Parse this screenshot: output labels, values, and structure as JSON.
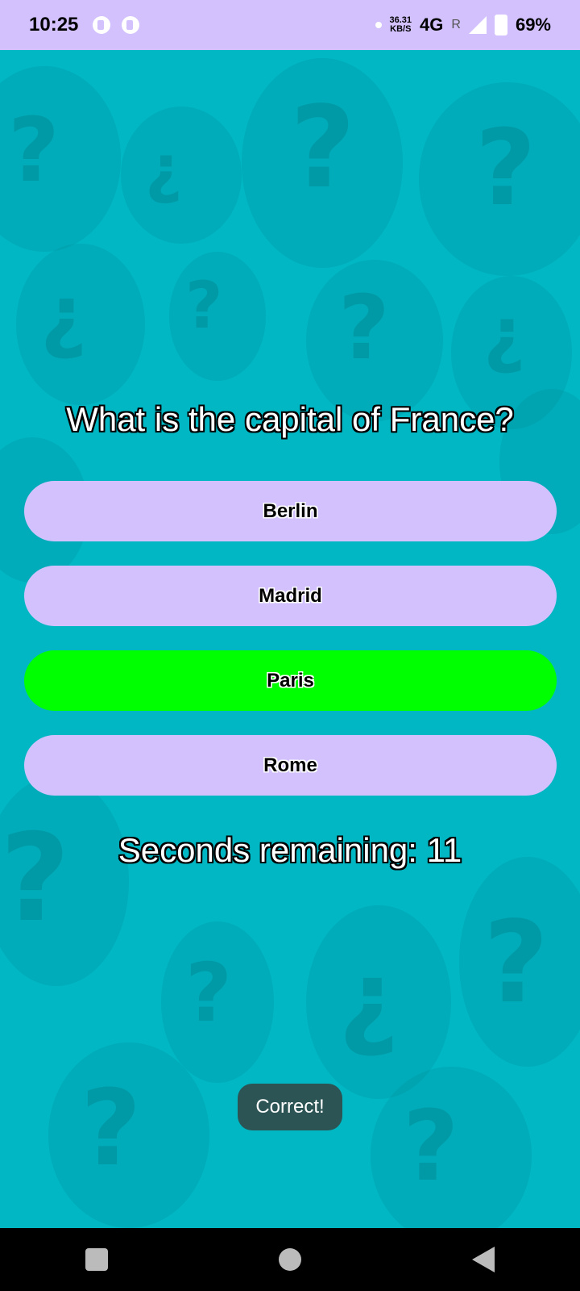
{
  "status_bar": {
    "time": "10:25",
    "speed": "36.31",
    "speed_unit": "KB/S",
    "network": "4G",
    "roaming": "R",
    "battery": "69%"
  },
  "quiz": {
    "question": "What is the capital of France?",
    "answers": [
      {
        "label": "Berlin"
      },
      {
        "label": "Madrid"
      },
      {
        "label": "Paris"
      },
      {
        "label": "Rome"
      }
    ],
    "timer": "Seconds remaining: 11"
  },
  "toast": {
    "message": "Correct!"
  },
  "colors": {
    "accent": "#d2c1fd",
    "background": "#00b7c3",
    "correct": "#00ff00"
  }
}
